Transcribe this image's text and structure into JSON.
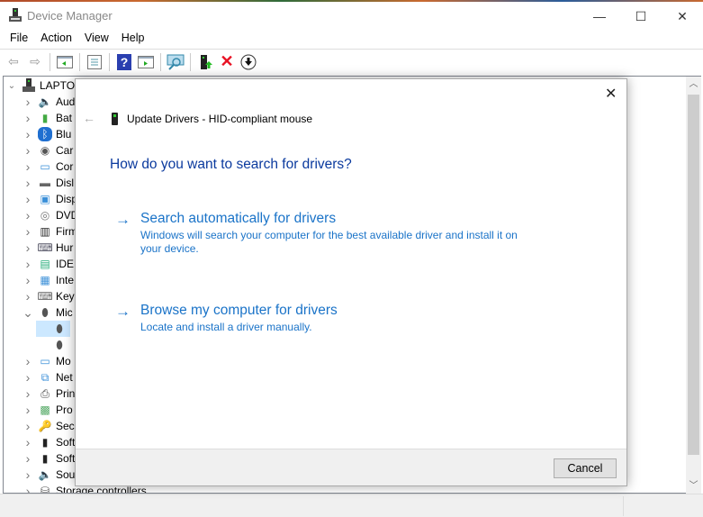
{
  "window": {
    "title": "Device Manager",
    "minimize": "—",
    "maximize": "☐",
    "close": "✕"
  },
  "menu": [
    "File",
    "Action",
    "View",
    "Help"
  ],
  "toolbar": {
    "icons": [
      "back-icon",
      "forward-icon",
      "show-hide-console-tree-icon",
      "properties-icon",
      "help-icon",
      "action-pane-icon",
      "scan-hardware-icon",
      "update-driver-icon",
      "uninstall-icon",
      "disable-device-icon"
    ],
    "accent_red": "#e81123"
  },
  "tree": {
    "root": "LAPTO",
    "items": [
      {
        "label": "Aud",
        "icon": "speaker",
        "expanded": false
      },
      {
        "label": "Bat",
        "icon": "battery",
        "expanded": false
      },
      {
        "label": "Blu",
        "icon": "bluetooth",
        "expanded": false
      },
      {
        "label": "Car",
        "icon": "camera",
        "expanded": false
      },
      {
        "label": "Cor",
        "icon": "computer",
        "expanded": false
      },
      {
        "label": "Disl",
        "icon": "disk",
        "expanded": false
      },
      {
        "label": "Disp",
        "icon": "display",
        "expanded": false
      },
      {
        "label": "DVD",
        "icon": "dvd",
        "expanded": false
      },
      {
        "label": "Firm",
        "icon": "chip",
        "expanded": false
      },
      {
        "label": "Hur",
        "icon": "hid",
        "expanded": false
      },
      {
        "label": "IDE",
        "icon": "ide",
        "expanded": false
      },
      {
        "label": "Inte",
        "icon": "interface",
        "expanded": false
      },
      {
        "label": "Key",
        "icon": "keyboard",
        "expanded": false
      },
      {
        "label": "Mic",
        "icon": "mouse",
        "expanded": true
      },
      {
        "label": "",
        "icon": "mouse",
        "child": true,
        "selected": true
      },
      {
        "label": "",
        "icon": "mouse",
        "child": true
      },
      {
        "label": "Mo",
        "icon": "monitor",
        "expanded": false
      },
      {
        "label": "Net",
        "icon": "network",
        "expanded": false
      },
      {
        "label": "Prin",
        "icon": "printer",
        "expanded": false
      },
      {
        "label": "Pro",
        "icon": "processor",
        "expanded": false
      },
      {
        "label": "Sec",
        "icon": "security",
        "expanded": false
      },
      {
        "label": "Soft",
        "icon": "software-component",
        "expanded": false
      },
      {
        "label": "Soft",
        "icon": "software-device",
        "expanded": false
      },
      {
        "label": "Sou",
        "icon": "speaker",
        "expanded": false
      },
      {
        "label": "Storage controllers",
        "icon": "storage",
        "expanded": false
      }
    ]
  },
  "dialog": {
    "header": "Update Drivers - HID-compliant mouse",
    "close": "✕",
    "back": "←",
    "heading": "How do you want to search for drivers?",
    "options": [
      {
        "label": "Search automatically for drivers",
        "description": "Windows will search your computer for the best available driver and install it on your device."
      },
      {
        "label": "Browse my computer for drivers",
        "description": "Locate and install a driver manually."
      }
    ],
    "cancel": "Cancel",
    "link_color": "#1a73c8",
    "heading_color": "#0b3a9e"
  }
}
